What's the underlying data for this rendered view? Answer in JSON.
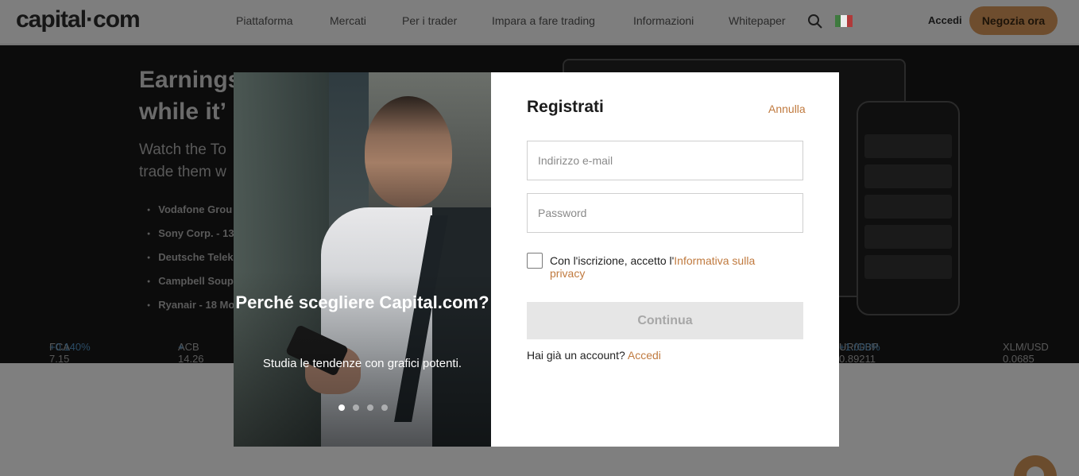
{
  "header": {
    "logo": "capital",
    "logo_dot": "·",
    "logo_suffix": "com",
    "nav": [
      "Piattaforma",
      "Mercati",
      "Per i trader",
      "Impara a fare trading",
      "Informazioni",
      "Whitepaper"
    ],
    "search_icon": "search-icon",
    "flag": [
      "#3f7a3f",
      "#ececec",
      "#b03a3a"
    ],
    "login": "Accedi",
    "cta": "Negozia ora"
  },
  "hero": {
    "title_line1": "Earnings",
    "title_line2": "while it’",
    "sub_line1": "Watch the To",
    "sub_line2": "trade them w",
    "list": [
      "Vodafone Grou",
      "Sony Corp. - 13",
      "Deutsche Telek",
      "Campbell Soup",
      "Ryanair - 18 Mo"
    ]
  },
  "ticker": [
    {
      "name": "FCA 7.15",
      "change": "+0.140%"
    },
    {
      "name": "ACB 14.26",
      "change": "+"
    },
    {
      "name": "UR/GBP 0.89211",
      "change": "+1.000%"
    },
    {
      "name": "XLM/USD 0.0685",
      "change": ""
    }
  ],
  "promo": {
    "title": "Perché scegliere Capital.com?",
    "text": "Studia le tendenze con grafici potenti.",
    "slides": 4,
    "active_slide": 0
  },
  "form": {
    "title": "Registrati",
    "cancel": "Annulla",
    "email_placeholder": "Indirizzo e-mail",
    "password_placeholder": "Password",
    "consent_prefix": "Con l'iscrizione, accetto l'",
    "consent_link": "Informativa sulla privacy",
    "continue": "Continua",
    "account_prefix": "Hai già un account?",
    "account_link": "Accedi"
  },
  "colors": {
    "accent": "#c07a3f",
    "cta_bg": "#6e4d2e",
    "disabled_bg": "#e6e6e6"
  }
}
